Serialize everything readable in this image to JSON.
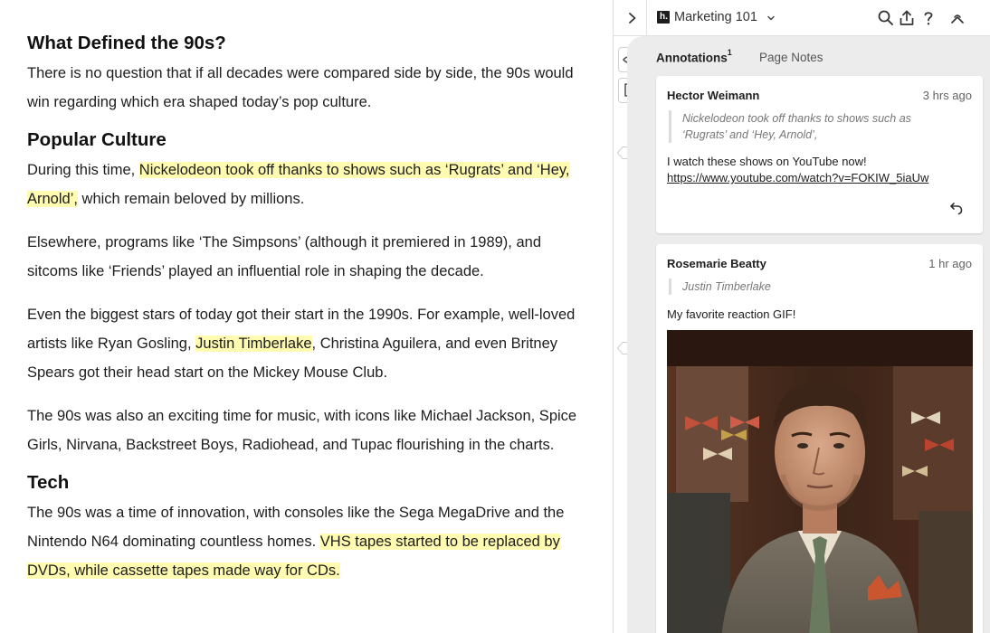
{
  "article": {
    "h1": "What Defined the 90s?",
    "p1": "There is no question that if all decades were compared side by side, the 90s would win regarding which era shaped today’s pop culture.",
    "h2": "Popular Culture",
    "p2_a": "During this time, ",
    "p2_hl": "Nickelodeon took off thanks to shows such as ‘Rugrats’ and ‘Hey, Arnold’,",
    "p2_b": " which remain beloved by millions.",
    "p3": "Elsewhere, programs like ‘The Simpsons’ (although it premiered in 1989), and sitcoms like ‘Friends’ played an influential role in shaping the decade.",
    "p4_a": "Even the biggest stars of today got their start in the 1990s. For example, well-loved artists like Ryan Gosling, ",
    "p4_hl": "Justin Timberlake",
    "p4_b": ", Christina Aguilera, and even Britney Spears got their head start on the Mickey Mouse Club.",
    "p5": "The 90s was also an exciting time for music, with icons like Michael Jackson, Spice Girls, Nirvana, Backstreet Boys, Radiohead, and Tupac flourishing in the charts.",
    "h3": "Tech",
    "p6_a": "The 90s was a time of innovation, with consoles like the Sega MegaDrive and the Nintendo N64 dominating countless homes. ",
    "p6_hl": "VHS tapes started to be replaced by DVDs, while cassette tapes made way for CDs."
  },
  "sidebar": {
    "logo_letter": "h.",
    "group_name": "Marketing 101",
    "icons": [
      "chevron-right-icon",
      "search-icon",
      "share-icon",
      "help-icon",
      "account-icon",
      "eye-icon",
      "page-note-icon",
      "reply-icon"
    ],
    "tabs": {
      "annotations_label": "Annotations",
      "annotations_count": "1",
      "page_notes_label": "Page Notes"
    },
    "buckets": [
      "1",
      "2"
    ],
    "annotations": [
      {
        "user": "Hector Weimann",
        "time": "3 hrs ago",
        "quote": "Nickelodeon took off thanks to shows such as ‘Rugrats’ and ‘Hey, Arnold’,",
        "text": "I watch these shows on YouTube now!",
        "link": "https://www.youtube.com/watch?v=FOKIW_5iaUw"
      },
      {
        "user": "Rosemarie Beatty",
        "time": "1 hr ago",
        "quote": "Justin Timberlake",
        "text": "My favorite reaction GIF!"
      }
    ]
  },
  "colors": {
    "highlight": "#fffbb0",
    "sidebar_bg": "#ececec",
    "card_bg": "#ffffff"
  }
}
